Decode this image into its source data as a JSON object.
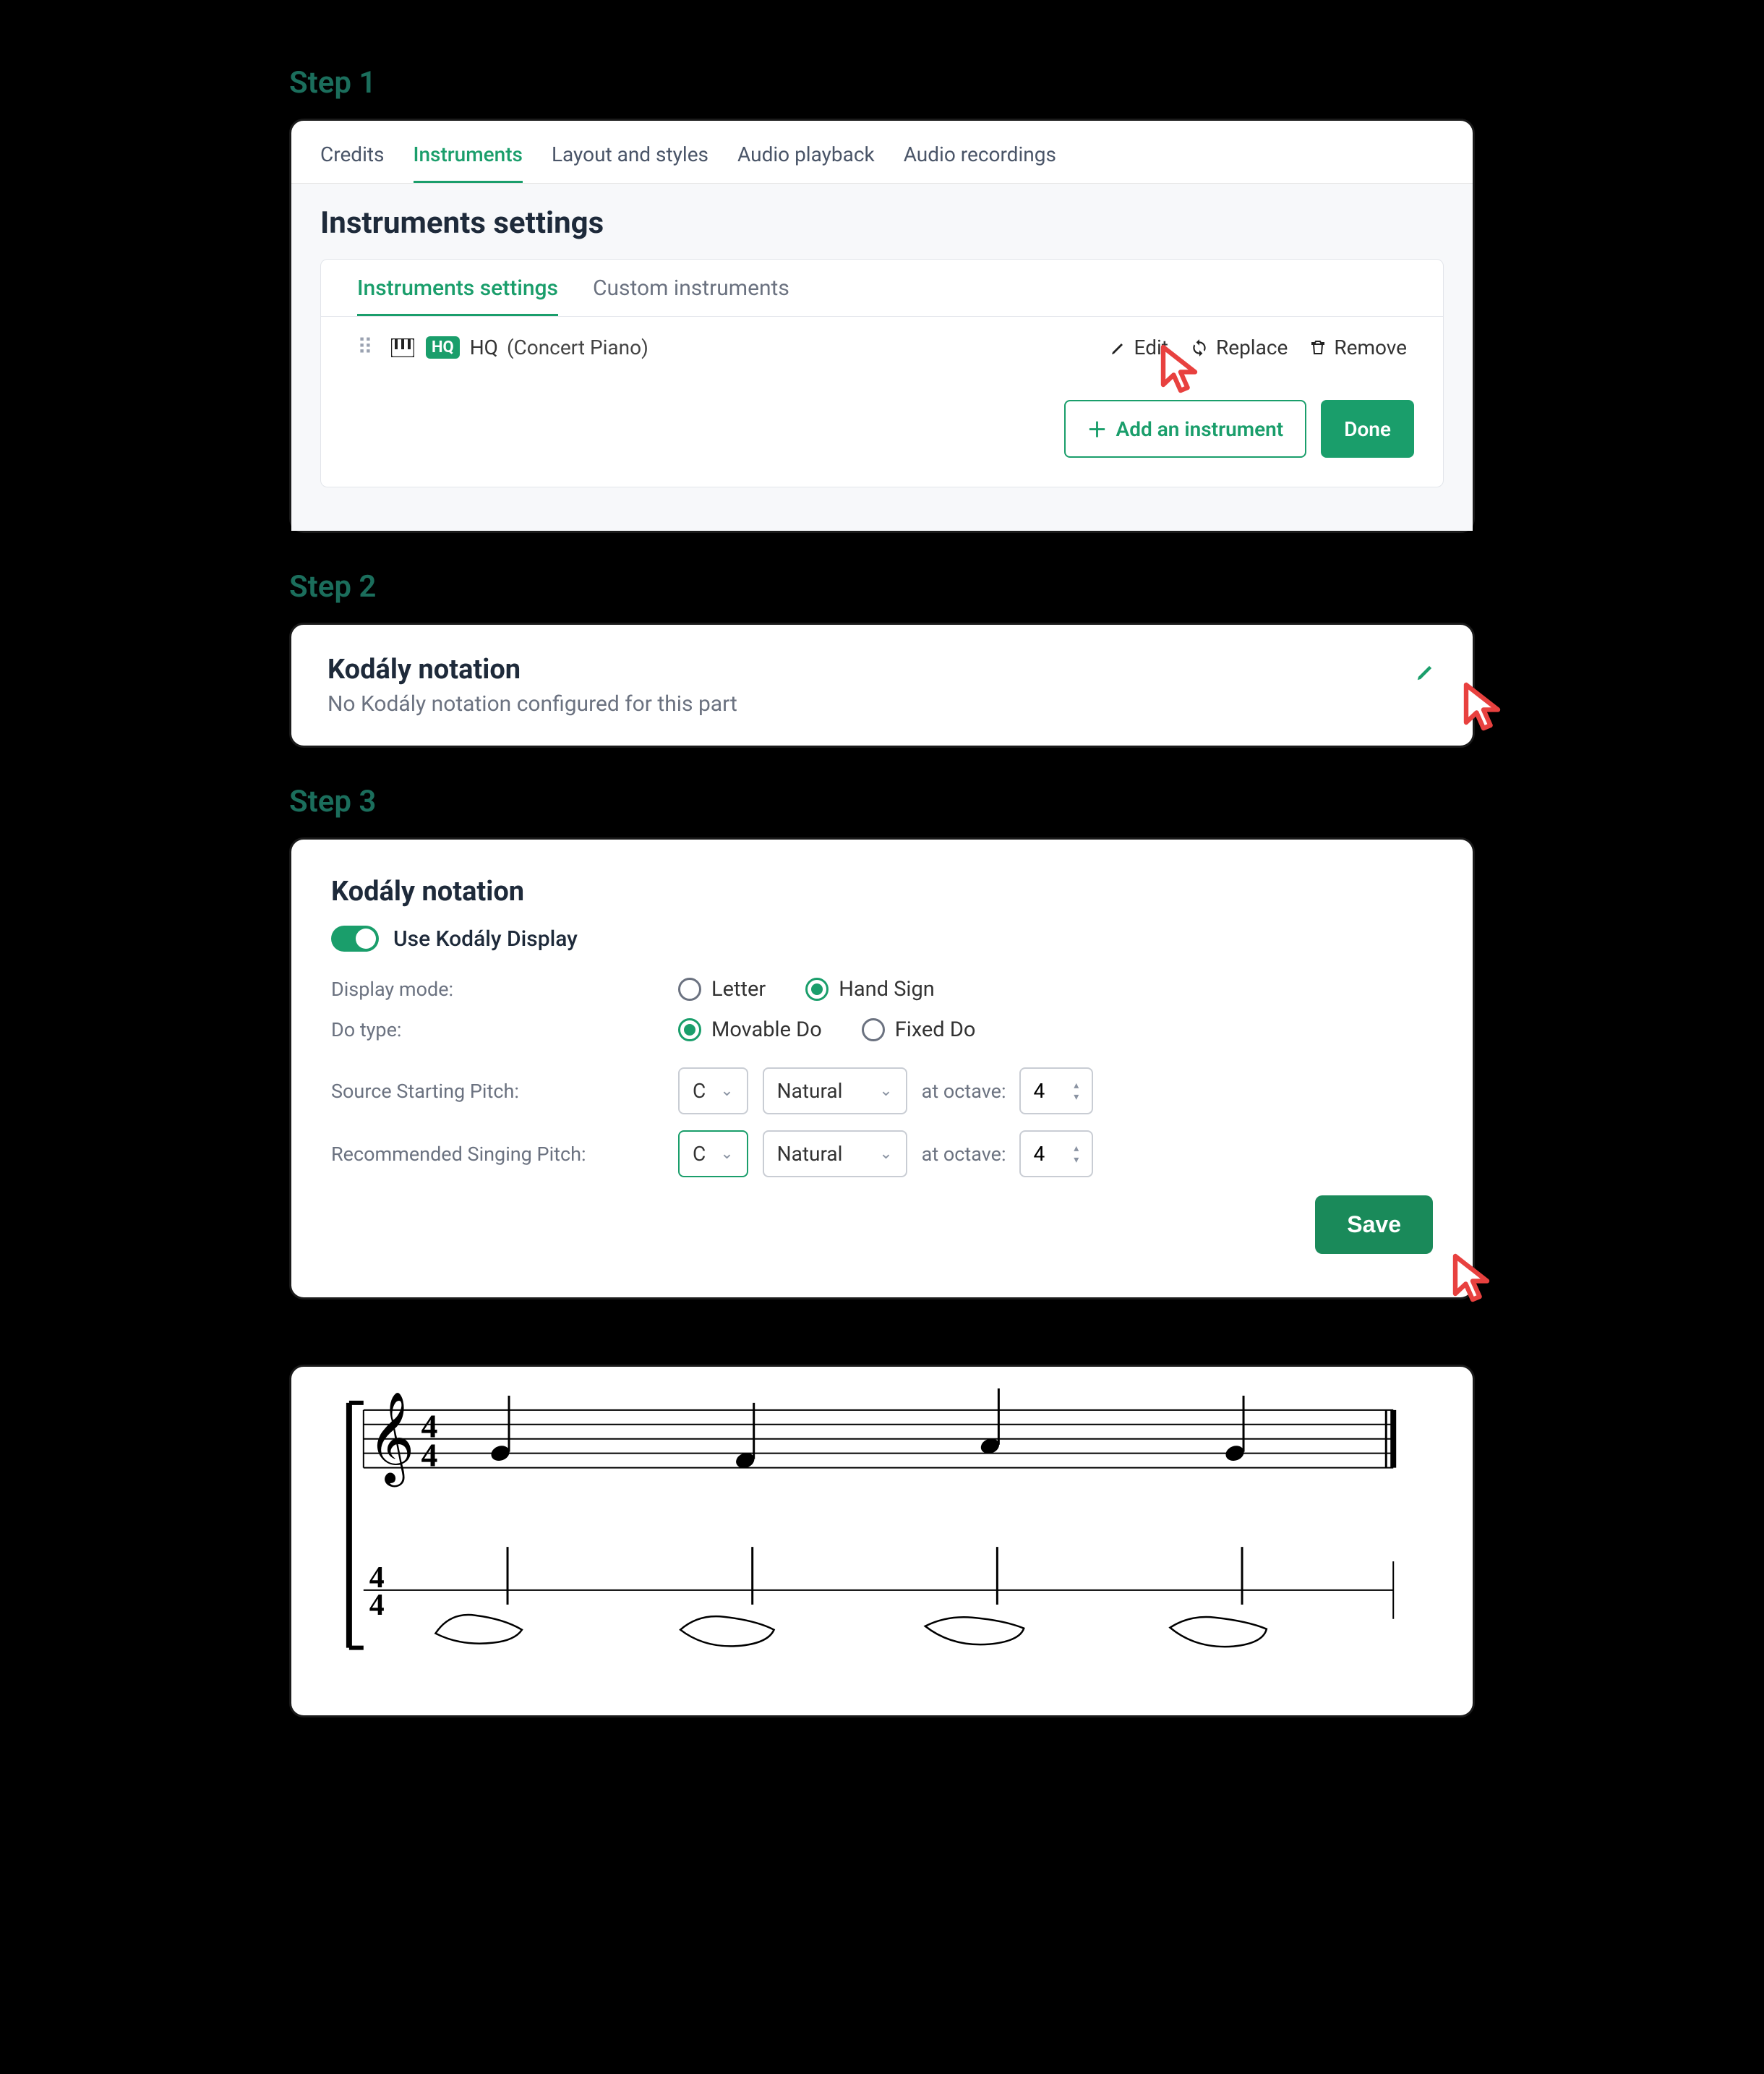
{
  "steps": {
    "s1": "Step 1",
    "s2": "Step 2",
    "s3": "Step 3"
  },
  "topTabs": {
    "credits": "Credits",
    "instruments": "Instruments",
    "layout": "Layout and styles",
    "audioPlayback": "Audio playback",
    "audioRecordings": "Audio recordings"
  },
  "settings": {
    "title": "Instruments settings",
    "innerTabs": {
      "settings": "Instruments settings",
      "custom": "Custom instruments"
    },
    "row": {
      "hqBadge": "HQ",
      "hqText": "HQ",
      "name": "(Concert Piano)"
    },
    "actions": {
      "edit": "Edit",
      "replace": "Replace",
      "remove": "Remove",
      "add": "Add an instrument",
      "done": "Done"
    }
  },
  "kodaly": {
    "title": "Kodály notation",
    "subtitle": "No Kodály notation configured for this part"
  },
  "step3": {
    "title": "Kodály notation",
    "toggleLabel": "Use Kodály Display",
    "displayMode": {
      "label": "Display mode:",
      "letter": "Letter",
      "hand": "Hand Sign"
    },
    "doType": {
      "label": "Do type:",
      "movable": "Movable Do",
      "fixed": "Fixed Do"
    },
    "source": {
      "label": "Source Starting Pitch:",
      "note": "C",
      "accidental": "Natural",
      "atOctave": "at octave:",
      "octave": "4"
    },
    "singing": {
      "label": "Recommended Singing Pitch:",
      "note": "C",
      "accidental": "Natural",
      "atOctave": "at octave:",
      "octave": "4"
    },
    "save": "Save"
  },
  "score": {
    "timeSig": "4/4"
  }
}
